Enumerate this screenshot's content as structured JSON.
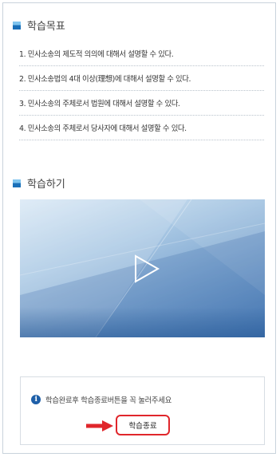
{
  "goals_section": {
    "title": "학습목표",
    "items": [
      "1. 민사소송의 제도적 의의에 대해서 설명할 수 있다.",
      "2. 민사소송법의 4대 이상(理想)에 대해서 설명할 수 있다.",
      "3. 민사소송의 주체로서 법원에 대해서 설명할 수 있다.",
      "4. 민사소송의 주체로서 당사자에 대해서 설명할 수 있다."
    ]
  },
  "study_section": {
    "title": "학습하기"
  },
  "video": {
    "play_icon": "play-icon"
  },
  "notice": {
    "info_icon": "info-icon",
    "info_icon_glyph": "i",
    "message": "학습완료후 학습종료버튼을 꼭 눌러주세요",
    "end_button_label": "학습종료"
  },
  "colors": {
    "marker_dark": "#1a6fb8",
    "marker_light": "#7fc4ee",
    "highlight_red": "#e0262b",
    "info_blue": "#1e5fa8"
  }
}
